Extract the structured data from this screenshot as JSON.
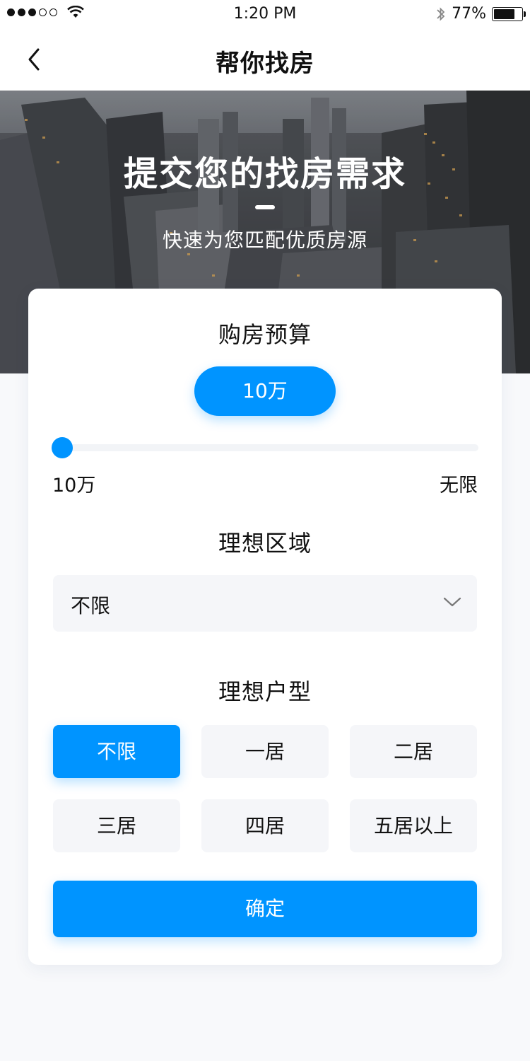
{
  "status_bar": {
    "time": "1:20 PM",
    "battery": "77%",
    "battery_level": 0.77,
    "signal_bars": 3,
    "signal_total": 5
  },
  "nav": {
    "title": "帮你找房",
    "back_icon": "chevron-left-icon"
  },
  "hero": {
    "title": "提交您的找房需求",
    "subtitle": "快速为您匹配优质房源"
  },
  "budget": {
    "title": "购房预算",
    "current_value": "10万",
    "min_label": "10万",
    "max_label": "无限",
    "slider_fraction": 0.0
  },
  "area": {
    "title": "理想区域",
    "selected": "不限",
    "dropdown_icon": "chevron-down-icon"
  },
  "layout": {
    "title": "理想户型",
    "options": [
      "不限",
      "一居",
      "二居",
      "三居",
      "四居",
      "五居以上"
    ],
    "selected_index": 0
  },
  "confirm_label": "确定",
  "colors": {
    "accent": "#0094ff",
    "option_bg": "#f5f6f9"
  }
}
